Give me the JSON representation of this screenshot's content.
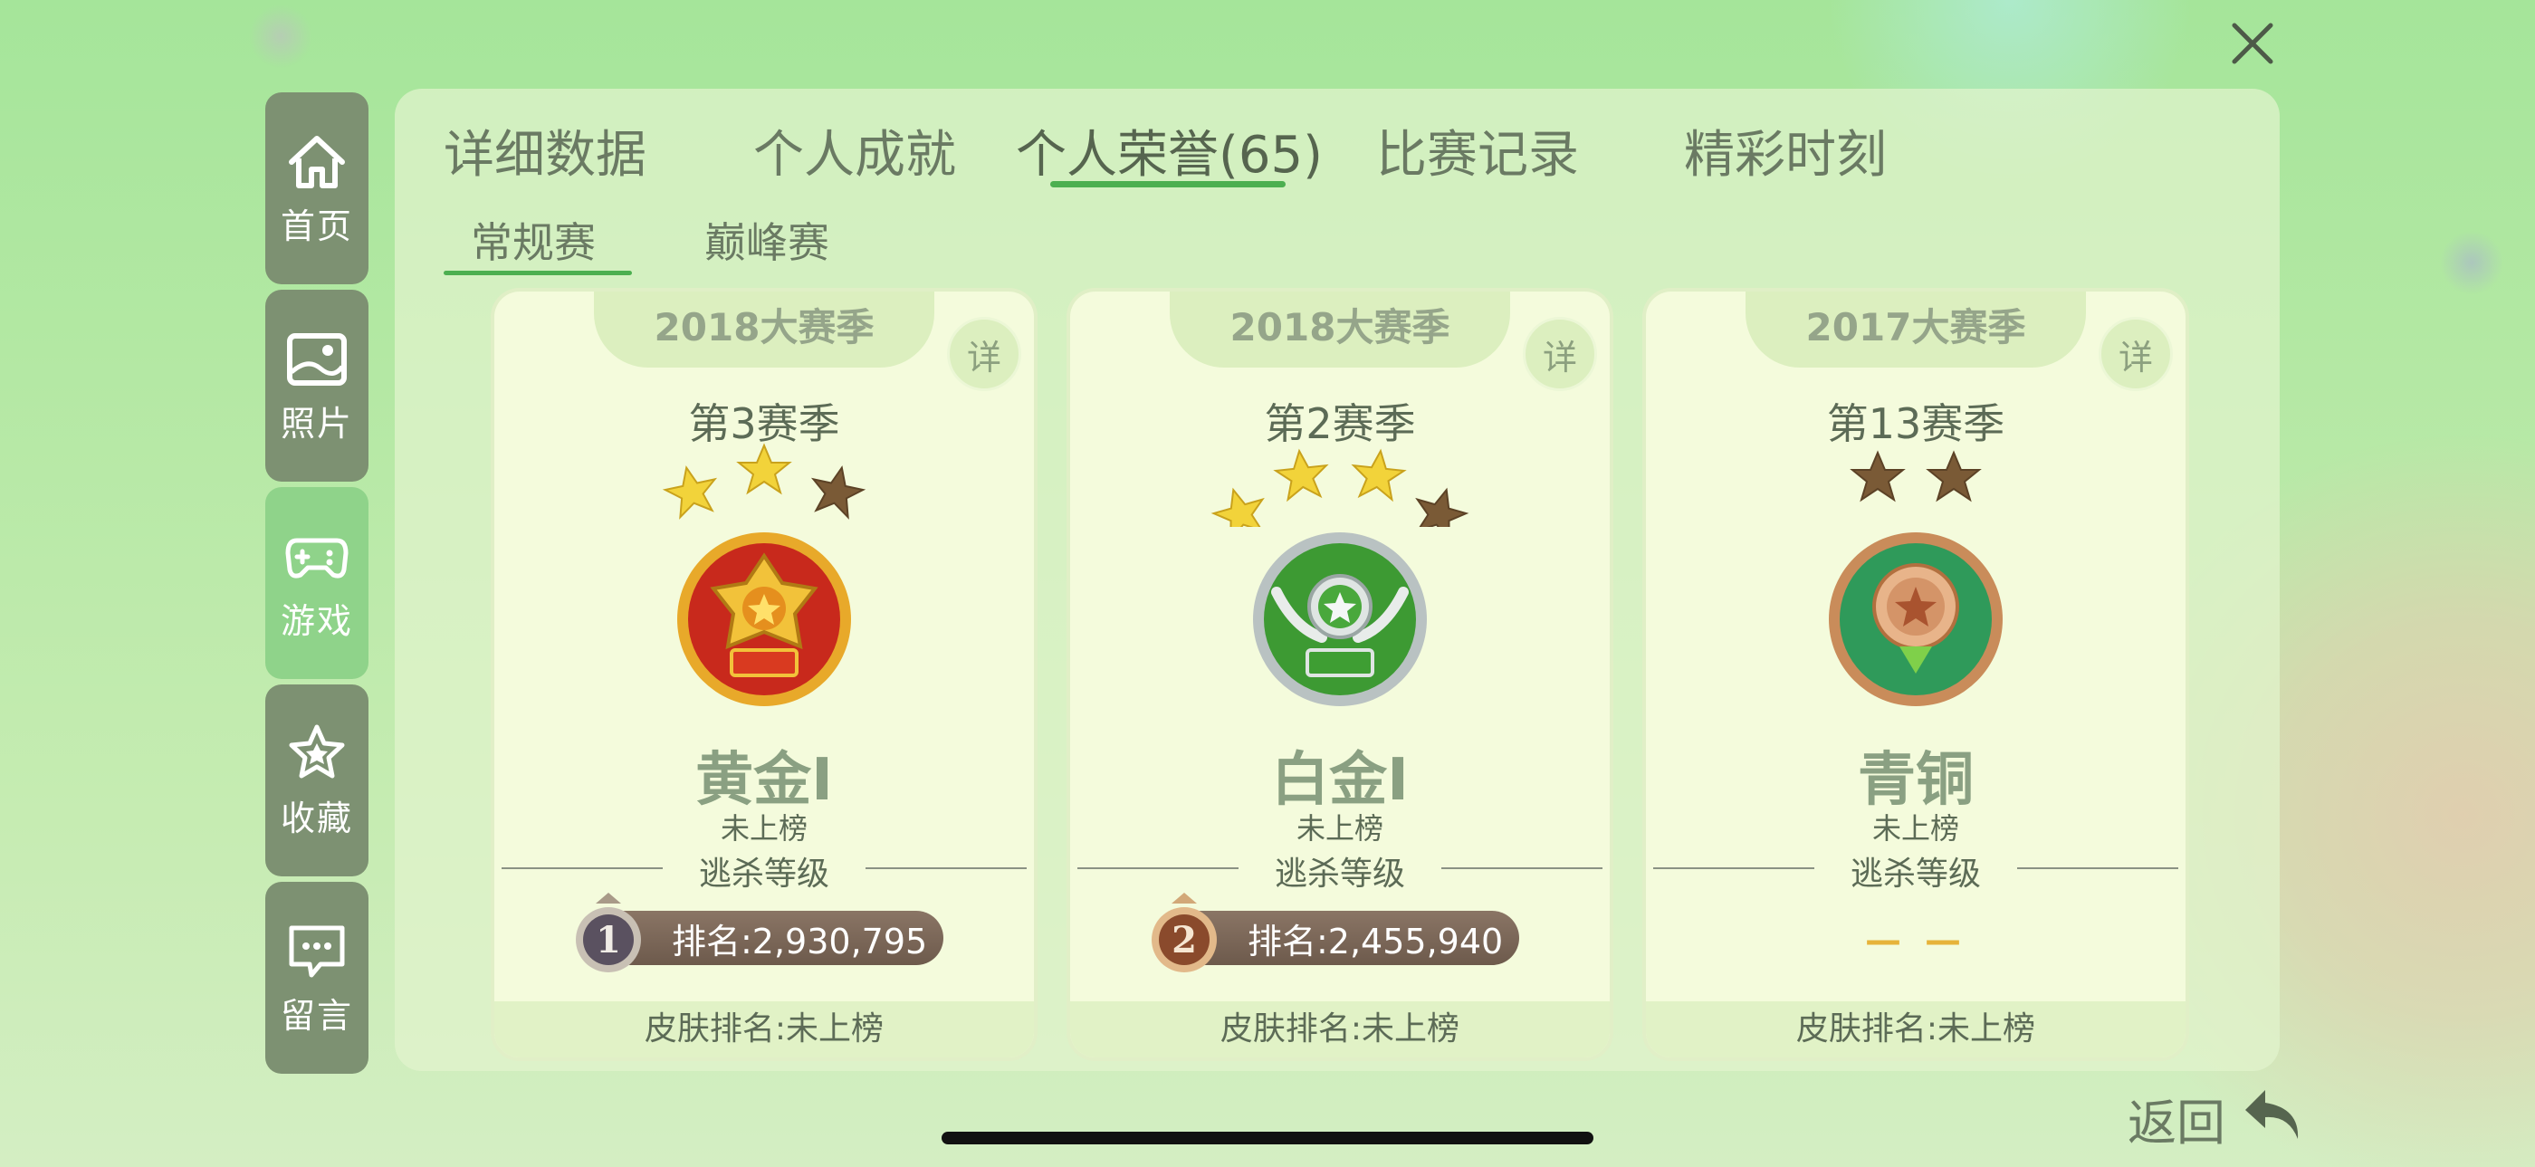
{
  "close": {
    "icon": "close-icon"
  },
  "sidebar": {
    "items": [
      {
        "label": "首页",
        "icon": "home-icon",
        "active": false
      },
      {
        "label": "照片",
        "icon": "photo-icon",
        "active": false
      },
      {
        "label": "游戏",
        "icon": "gamepad-icon",
        "active": true
      },
      {
        "label": "收藏",
        "icon": "star-icon",
        "active": false
      },
      {
        "label": "留言",
        "icon": "message-icon",
        "active": false
      }
    ]
  },
  "tabs": [
    {
      "label": "详细数据",
      "active": false
    },
    {
      "label": "个人成就",
      "active": false
    },
    {
      "label": "个人荣誉(65)",
      "active": true
    },
    {
      "label": "比赛记录",
      "active": false
    },
    {
      "label": "精彩时刻",
      "active": false
    }
  ],
  "subtabs": [
    {
      "label": "常规赛",
      "active": true
    },
    {
      "label": "巅峰赛",
      "active": false
    }
  ],
  "cards": [
    {
      "season_year": "2018大赛季",
      "detail_label": "详",
      "season": "第3赛季",
      "stars_filled": 2,
      "stars_total": 3,
      "medal": "gold-medal-icon",
      "rank": "黄金I",
      "status": "未上榜",
      "escape_label": "逃杀等级",
      "escape_badge": "1",
      "escape_rank": "排名:2,930,795",
      "skin_rank": "皮肤排名:未上榜"
    },
    {
      "season_year": "2018大赛季",
      "detail_label": "详",
      "season": "第2赛季",
      "stars_filled": 3,
      "stars_total": 4,
      "medal": "platinum-medal-icon",
      "rank": "白金I",
      "status": "未上榜",
      "escape_label": "逃杀等级",
      "escape_badge": "2",
      "escape_rank": "排名:2,455,940",
      "skin_rank": "皮肤排名:未上榜"
    },
    {
      "season_year": "2017大赛季",
      "detail_label": "详",
      "season": "第13赛季",
      "stars_filled": 0,
      "stars_total": 2,
      "medal": "bronze-medal-icon",
      "rank": "青铜",
      "status": "未上榜",
      "escape_label": "逃杀等级",
      "escape_rank": "— —",
      "skin_rank": "皮肤排名:未上榜"
    }
  ],
  "back": {
    "label": "返回",
    "icon": "back-arrow-icon"
  },
  "colors": {
    "accent": "#4caf50",
    "sidebar": "#7d9172",
    "sidebar_active": "#8fd38a"
  }
}
